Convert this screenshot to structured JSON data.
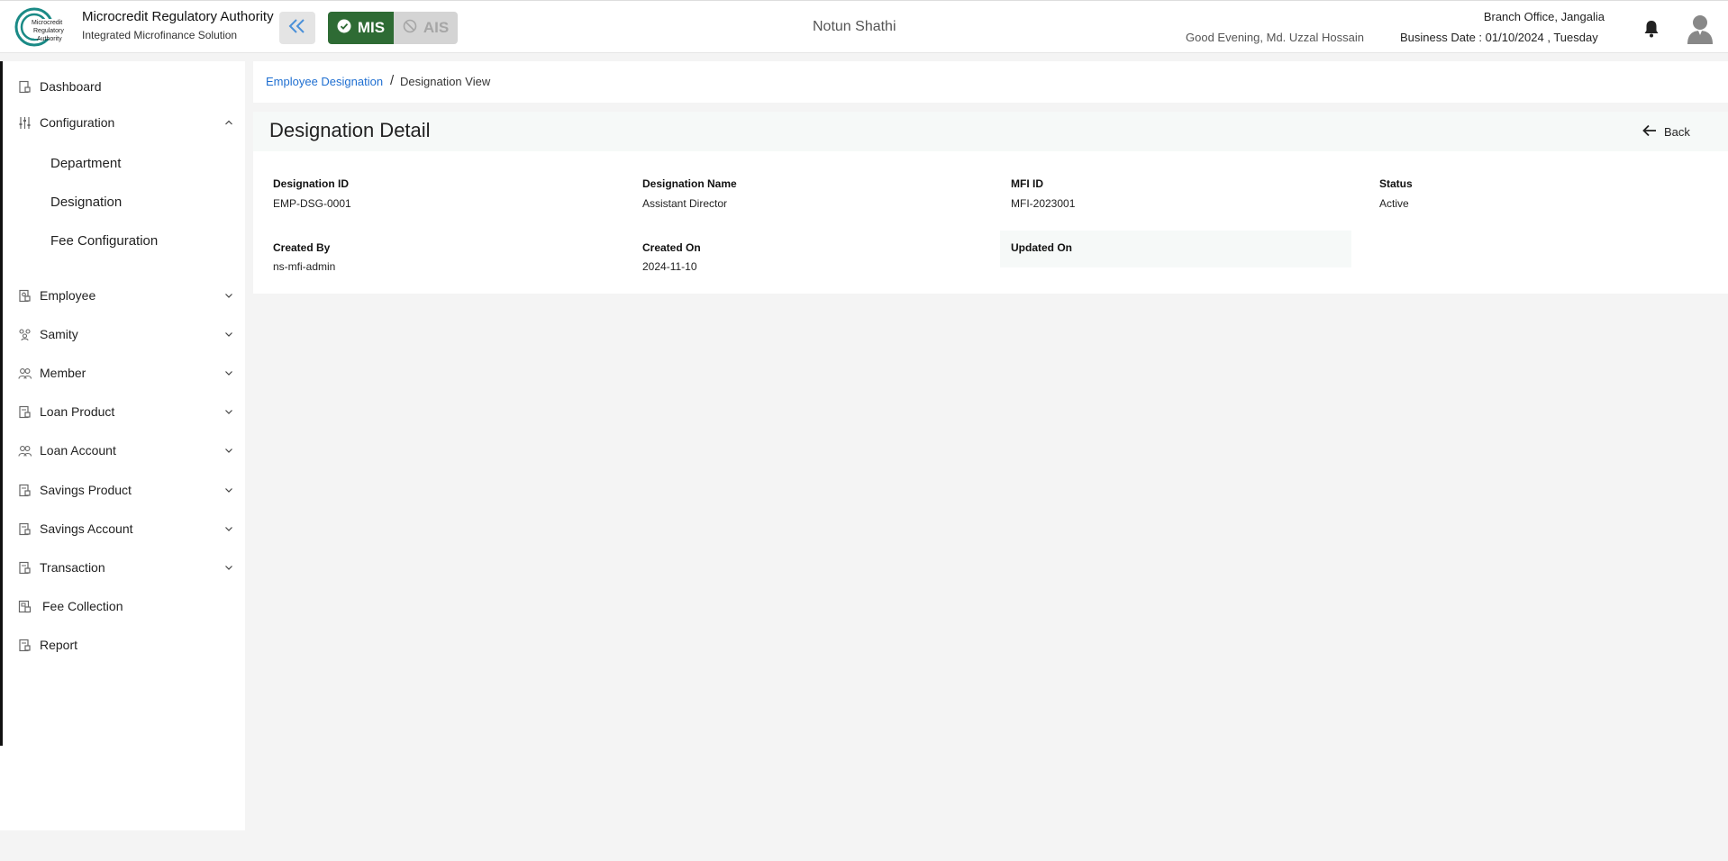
{
  "header": {
    "org_name": "Microcredit Regulatory Authority",
    "org_sub": "Integrated Microfinance Solution",
    "logo_text": [
      "Microcredit",
      "Regulatory",
      "Authority"
    ],
    "mode_mis": "MIS",
    "mode_ais": "AIS",
    "app_title": "Notun Shathi",
    "greeting": "Good Evening, Md. Uzzal Hossain",
    "branch": "Branch Office, Jangalia",
    "business_date": "Business Date : 01/10/2024 , Tuesday"
  },
  "sidebar": {
    "dashboard": "Dashboard",
    "configuration": "Configuration",
    "config_children": [
      "Department",
      "Designation",
      "Fee Configuration"
    ],
    "employee": "Employee",
    "samity": "Samity",
    "member": "Member",
    "loan_product": "Loan Product",
    "loan_account": "Loan Account",
    "savings_product": "Savings Product",
    "savings_account": "Savings Account",
    "transaction": "Transaction",
    "fee_collection": "Fee Collection",
    "report": "Report"
  },
  "breadcrumb": {
    "parent": "Employee Designation",
    "separator": "/",
    "current": "Designation View"
  },
  "detail": {
    "title": "Designation Detail",
    "back_label": "Back",
    "fields": [
      {
        "label": "Designation ID",
        "value": "EMP-DSG-0001"
      },
      {
        "label": "Designation Name",
        "value": "Assistant Director"
      },
      {
        "label": "MFI ID",
        "value": "MFI-2023001"
      },
      {
        "label": "Status",
        "value": "Active"
      },
      {
        "label": "Created By",
        "value": "ns-mfi-admin"
      },
      {
        "label": "Created On",
        "value": "2024-11-10"
      },
      {
        "label": "Updated On",
        "value": ""
      }
    ]
  },
  "colors": {
    "accent_green": "#2e6b34",
    "link_blue": "#1f6fd1",
    "logo_teal": "#1a8a86"
  }
}
